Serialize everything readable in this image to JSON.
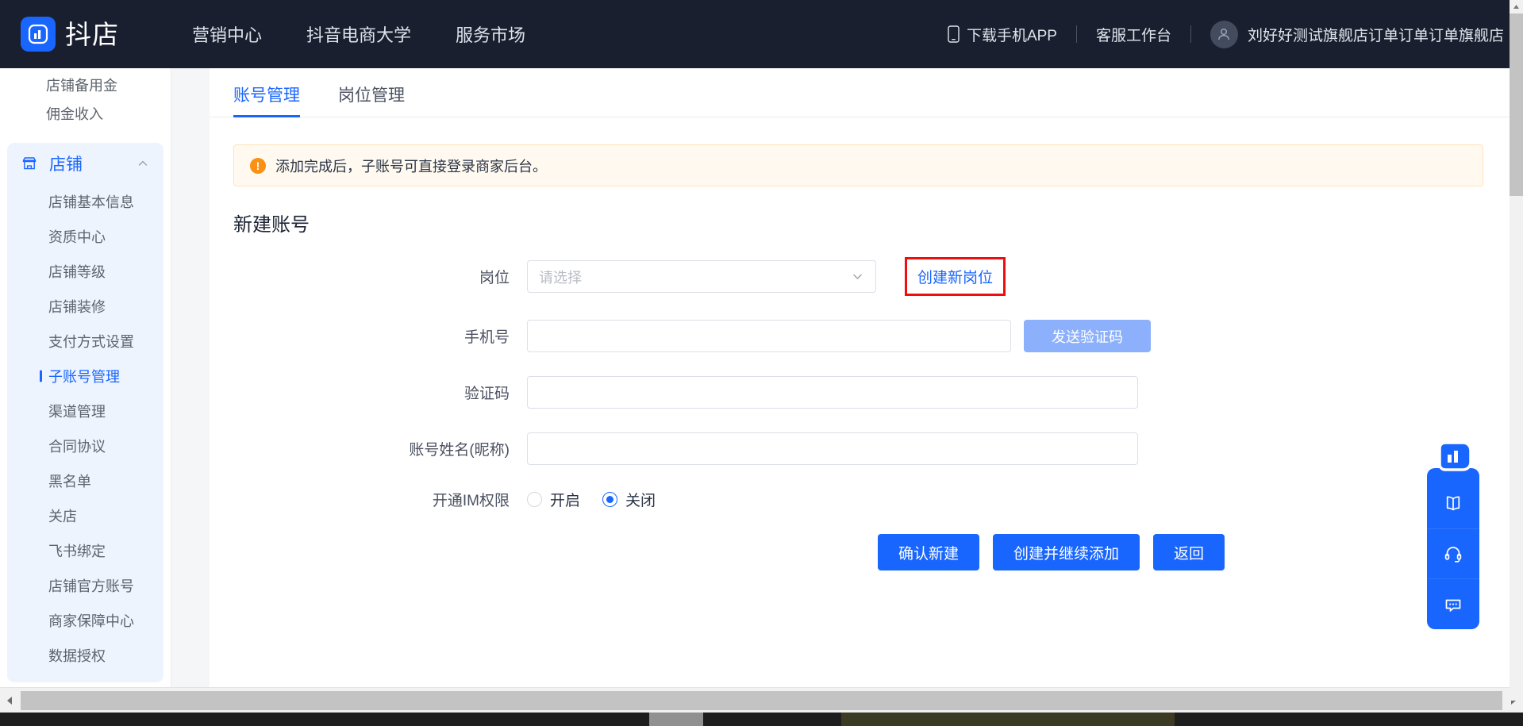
{
  "header": {
    "brand_name": "抖店",
    "logo_icon": "doudian-logo-icon",
    "nav": [
      {
        "label": "营销中心"
      },
      {
        "label": "抖音电商大学"
      },
      {
        "label": "服务市场"
      }
    ],
    "download_app": {
      "label": "下载手机APP",
      "icon": "mobile-phone-icon"
    },
    "service_desk": {
      "label": "客服工作台"
    },
    "account": {
      "name": "刘好好测试旗舰店订单订单订单旗舰店",
      "icon": "user-avatar-icon"
    }
  },
  "sidebar": {
    "top_items": [
      {
        "label": "店铺备用金"
      },
      {
        "label": "佣金收入"
      }
    ],
    "group": {
      "title": "店铺",
      "icon": "shop-icon",
      "chevron": "chevron-up-icon",
      "items": [
        {
          "label": "店铺基本信息",
          "active": false
        },
        {
          "label": "资质中心",
          "active": false
        },
        {
          "label": "店铺等级",
          "active": false
        },
        {
          "label": "店铺装修",
          "active": false
        },
        {
          "label": "支付方式设置",
          "active": false
        },
        {
          "label": "子账号管理",
          "active": true
        },
        {
          "label": "渠道管理",
          "active": false
        },
        {
          "label": "合同协议",
          "active": false
        },
        {
          "label": "黑名单",
          "active": false
        },
        {
          "label": "关店",
          "active": false
        },
        {
          "label": "飞书绑定",
          "active": false
        },
        {
          "label": "店铺官方账号",
          "active": false
        },
        {
          "label": "商家保障中心",
          "active": false
        },
        {
          "label": "数据授权",
          "active": false
        }
      ]
    }
  },
  "main": {
    "tabs": [
      {
        "label": "账号管理",
        "active": true
      },
      {
        "label": "岗位管理",
        "active": false
      }
    ],
    "alert": {
      "icon": "warning-icon",
      "icon_glyph": "!",
      "text": "添加完成后，子账号可直接登录商家后台。"
    },
    "section_title": "新建账号",
    "form": {
      "position": {
        "label": "岗位",
        "placeholder": "请选择",
        "value": "",
        "caret_icon": "chevron-down-icon",
        "create_link": "创建新岗位"
      },
      "phone": {
        "label": "手机号",
        "value": "",
        "placeholder": "",
        "send_code_label": "发送验证码"
      },
      "code": {
        "label": "验证码",
        "value": "",
        "placeholder": ""
      },
      "nickname": {
        "label": "账号姓名(昵称)",
        "value": "",
        "placeholder": ""
      },
      "im_permission": {
        "label": "开通IM权限",
        "options": [
          {
            "label": "开启",
            "checked": false
          },
          {
            "label": "关闭",
            "checked": true
          }
        ]
      }
    },
    "buttons": [
      {
        "label": "确认新建"
      },
      {
        "label": "创建并继续添加"
      },
      {
        "label": "返回"
      }
    ]
  },
  "float_widget": {
    "logo_icon": "doudian-logo-icon",
    "buttons": [
      {
        "icon": "book-icon"
      },
      {
        "icon": "headset-icon"
      },
      {
        "icon": "chat-bubble-icon"
      }
    ]
  },
  "colors": {
    "accent": "#1966ff",
    "header_bg": "#191f2e",
    "highlight_box": "#f10d0d",
    "alert_bg": "#fff9f0",
    "alert_icon": "#fa9014"
  },
  "scrollbars": {
    "h_left_arrow": "arrow-left-icon",
    "h_right_arrow": "arrow-right-icon",
    "v_up_arrow": "arrow-up-icon"
  }
}
